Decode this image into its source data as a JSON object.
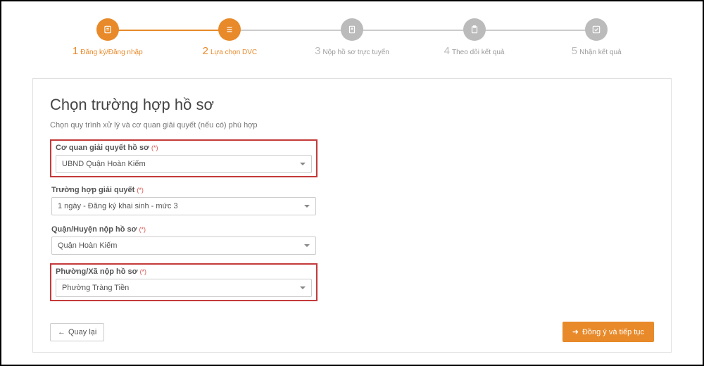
{
  "stepper": {
    "steps": [
      {
        "num": "1",
        "label": "Đăng ký/Đăng nhập",
        "icon": "user-icon",
        "active": true
      },
      {
        "num": "2",
        "label": "Lựa chọn DVC",
        "icon": "list-icon",
        "active": true
      },
      {
        "num": "3",
        "label": "Nộp hồ sơ trực tuyến",
        "icon": "file-icon",
        "active": false
      },
      {
        "num": "4",
        "label": "Theo dõi kết quả",
        "icon": "clipboard-icon",
        "active": false
      },
      {
        "num": "5",
        "label": "Nhận kết quả",
        "icon": "check-icon",
        "active": false
      }
    ]
  },
  "panel": {
    "title": "Chọn trường hợp hồ sơ",
    "description": "Chọn quy trình xử lý và cơ quan giải quyết (nếu có) phù hợp",
    "required_mark": "(*)",
    "fields": {
      "agency": {
        "label": "Cơ quan giải quyết hồ sơ",
        "value": "UBND Quận Hoàn Kiếm",
        "highlighted": true
      },
      "case": {
        "label": "Trường hợp giải quyết",
        "value": "1 ngày - Đăng ký khai sinh - mức 3",
        "highlighted": false
      },
      "district": {
        "label": "Quận/Huyện nộp hồ sơ",
        "value": "Quận Hoàn Kiếm",
        "highlighted": false
      },
      "ward": {
        "label": "Phường/Xã nộp hồ sơ",
        "value": "Phường Tràng Tiền",
        "highlighted": true
      }
    },
    "actions": {
      "back": "Quay lại",
      "next": "Đồng ý và tiếp tục"
    }
  },
  "colors": {
    "accent": "#e88a2a",
    "highlight_border": "#c43a3a"
  }
}
